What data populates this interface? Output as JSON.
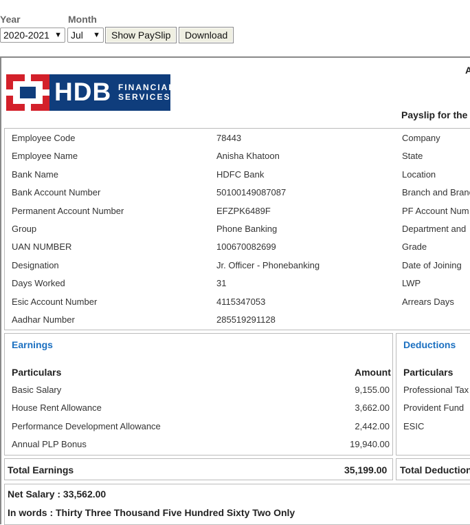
{
  "controls": {
    "year_label": "Year",
    "month_label": "Month",
    "year_value": "2020-2021",
    "month_value": "Jul",
    "show_button": "Show PaySlip",
    "download_button": "Download"
  },
  "header": {
    "logo_hdb": "HDB",
    "logo_line1": "FINANCIAL",
    "logo_line2": "SERVICES",
    "right_a": "A",
    "payslip_for": "Payslip for the m"
  },
  "employee": {
    "left": [
      {
        "label": "Employee Code",
        "value": "78443"
      },
      {
        "label": "Employee Name",
        "value": "Anisha Khatoon"
      },
      {
        "label": "Bank Name",
        "value": "HDFC Bank"
      },
      {
        "label": "Bank Account Number",
        "value": "50100149087087"
      },
      {
        "label": "Permanent Account Number",
        "value": "EFZPK6489F"
      },
      {
        "label": "Group",
        "value": "Phone Banking"
      },
      {
        "label": "UAN NUMBER",
        "value": "100670082699"
      },
      {
        "label": "Designation",
        "value": "Jr. Officer - Phonebanking"
      },
      {
        "label": "Days Worked",
        "value": "31"
      },
      {
        "label": "Esic Account Number",
        "value": "4115347053"
      },
      {
        "label": "Aadhar Number",
        "value": "285519291128"
      }
    ],
    "right": [
      "Company",
      "State",
      "Location",
      "Branch and Branc",
      "PF Account Num",
      "Department and",
      "Grade",
      "Date of Joining",
      "LWP",
      "Arrears Days"
    ]
  },
  "earnings": {
    "title": "Earnings",
    "col_particulars": "Particulars",
    "col_amount": "Amount",
    "items": [
      {
        "name": "Basic Salary",
        "amount": "9,155.00"
      },
      {
        "name": "House Rent Allowance",
        "amount": "3,662.00"
      },
      {
        "name": "Performance Development Allowance",
        "amount": "2,442.00"
      },
      {
        "name": "Annual PLP Bonus",
        "amount": "19,940.00"
      }
    ],
    "total_label": "Total Earnings",
    "total_value": "35,199.00"
  },
  "deductions": {
    "title": "Deductions",
    "col_particulars": "Particulars",
    "items": [
      "Professional Tax",
      "Provident Fund",
      "ESIC"
    ],
    "total_label": "Total Deductions"
  },
  "net": {
    "salary": "Net Salary : 33,562.00",
    "words": "In words : Thirty Three Thousand Five Hundred Sixty Two Only"
  }
}
